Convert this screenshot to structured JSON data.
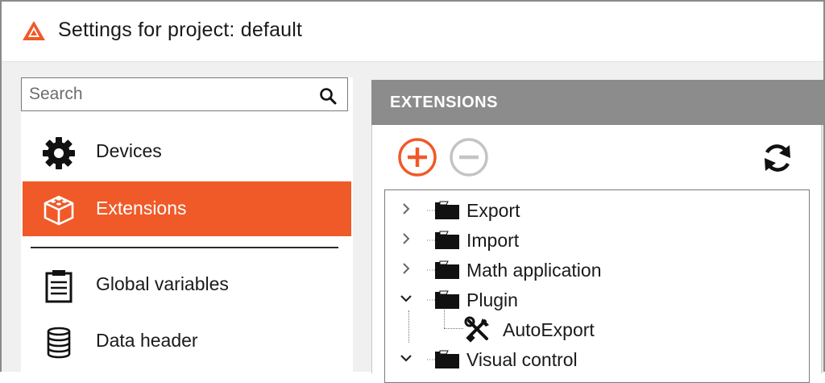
{
  "window": {
    "title": "Settings for project: default",
    "accent_color": "#f05a28"
  },
  "sidebar": {
    "search": {
      "placeholder": "Search"
    },
    "items": [
      {
        "label": "Devices",
        "icon": "gear-icon",
        "active": false
      },
      {
        "label": "Extensions",
        "icon": "extension-box-icon",
        "active": true
      },
      {
        "label": "Global variables",
        "icon": "clipboard-list-icon",
        "active": false
      },
      {
        "label": "Data header",
        "icon": "database-icon",
        "active": false
      }
    ]
  },
  "panel": {
    "header": "EXTENSIONS",
    "toolbar": {
      "add": "add-circle-icon",
      "remove": "remove-circle-icon",
      "refresh": "refresh-icon"
    },
    "tree": [
      {
        "label": "Export",
        "expanded": false
      },
      {
        "label": "Import",
        "expanded": false
      },
      {
        "label": "Math application",
        "expanded": false
      },
      {
        "label": "Plugin",
        "expanded": true,
        "children": [
          {
            "label": "AutoExport"
          }
        ]
      },
      {
        "label": "Visual control",
        "expanded": true
      }
    ]
  }
}
